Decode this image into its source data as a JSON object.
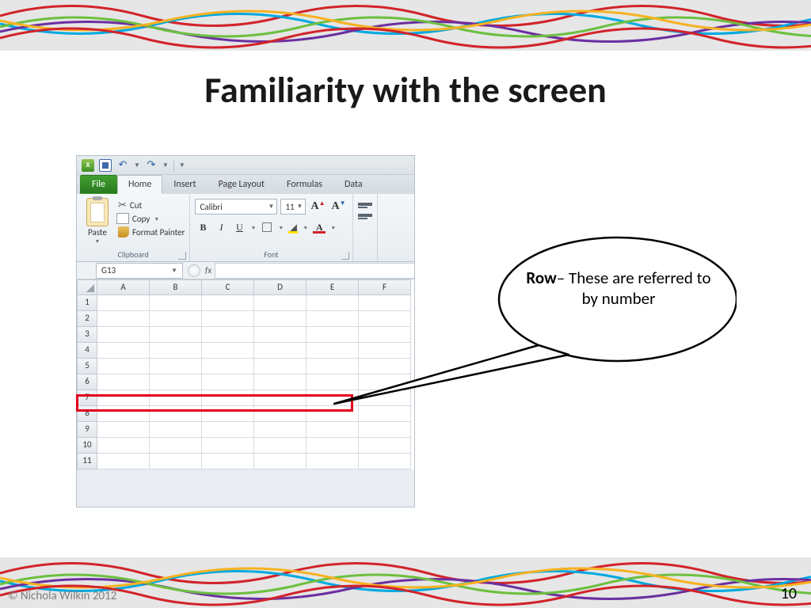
{
  "slide": {
    "title": "Familiarity with the screen",
    "page_number": "10",
    "copyright": "© Nichola Wilkin 2012"
  },
  "callout": {
    "label_bold": "Row",
    "label_rest": "– These are referred to by number"
  },
  "excel": {
    "tabs": {
      "file": "File",
      "home": "Home",
      "insert": "Insert",
      "page_layout": "Page Layout",
      "formulas": "Formulas",
      "data": "Data"
    },
    "clipboard": {
      "paste": "Paste",
      "cut": "Cut",
      "copy": "Copy",
      "format_painter": "Format Painter",
      "group_label": "Clipboard"
    },
    "font": {
      "name": "Calibri",
      "size": "11",
      "group_label": "Font"
    },
    "namebox": "G13",
    "fx": "fx",
    "columns": [
      "A",
      "B",
      "C",
      "D",
      "E",
      "F"
    ],
    "rows": [
      "1",
      "2",
      "3",
      "4",
      "5",
      "6",
      "7",
      "8",
      "9",
      "10",
      "11"
    ],
    "highlighted_row": "6"
  }
}
